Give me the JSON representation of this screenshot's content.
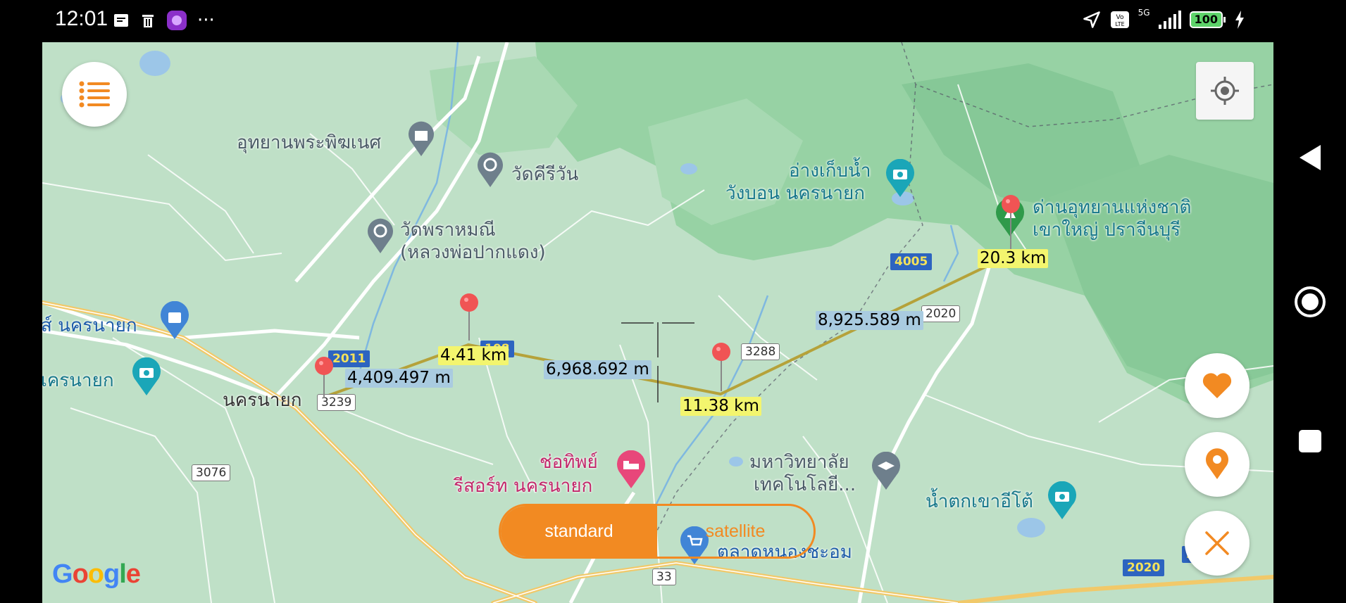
{
  "status_bar": {
    "time": "12:01",
    "battery": "100",
    "network": "5G"
  },
  "map": {
    "places": {
      "utthayan": "อุทยานพระพิฆเนศ",
      "wat_khiriwan": "วัดคีรีวัน",
      "wat_phrahmani_1": "วัดพราหมณี",
      "wat_phrahmani_2": "(หลวงพ่อปากแดง)",
      "nakhon_nayok_shop": "ส์ นครนายก",
      "nakhon_nayok_attr": "เครนายก",
      "nakhon_nayok_city": "นครนายก",
      "reservoir_1": "อ่างเก็บน้ำ",
      "reservoir_2": "วังบอน นครนายก",
      "park_1": "ด่านอุทยานแห่งชาติ",
      "park_2": "เขาใหญ่ ปราจีนบุรี",
      "resort_1": "ช่อทิพย์",
      "resort_2": "รีสอร์ท นครนายก",
      "university_1": "มหาวิทยาลัย",
      "university_2": "เทคโนโลยี...",
      "waterfall": "น้ำตกเขาอีโต้",
      "market": "ตลาดหนองชะอม"
    },
    "roads": {
      "r2011": "2011",
      "r3239": "3239",
      "r3076": "3076",
      "r108": "108",
      "r3288": "3288",
      "r4005": "4005",
      "r2020a": "2020",
      "r2020b": "2020",
      "r33": "33",
      "r2x": "2"
    },
    "measurements": {
      "seg1": "4,409.497 m",
      "seg2": "6,968.692 m",
      "seg3": "8,925.589 m",
      "total1": "4.41 km",
      "total2": "11.38 km",
      "total3": "20.3 km"
    },
    "toggle": {
      "standard": "standard",
      "satellite": "satellite"
    },
    "attribution": {
      "G": "G",
      "o1": "o",
      "o2": "o",
      "g": "g",
      "l": "l",
      "e": "e"
    }
  },
  "colors": {
    "accent": "#f28a22",
    "route": "#b5a23a",
    "pin": "#f05454",
    "map_bg": "#bfe0c7",
    "forest": "#8fcf9f"
  },
  "icons": {
    "menu": "list-icon",
    "locate": "crosshair-locate-icon",
    "favorite": "heart-icon",
    "pin_button": "map-pin-icon",
    "close": "close-icon"
  }
}
